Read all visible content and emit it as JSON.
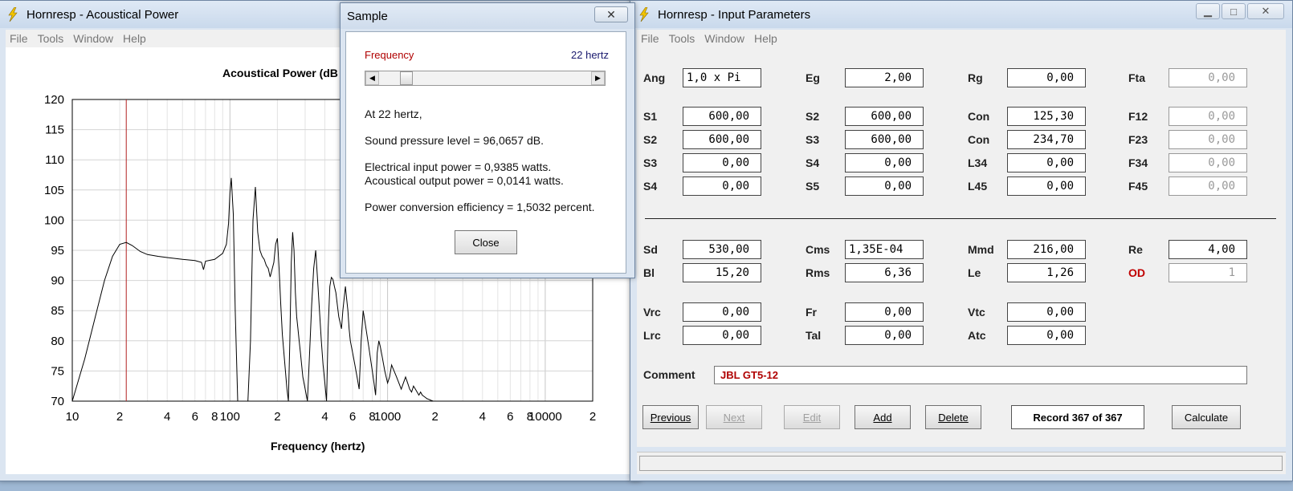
{
  "chart_window": {
    "title": "Hornresp - Acoustical Power",
    "menu": [
      "File",
      "Tools",
      "Window",
      "Help"
    ]
  },
  "chart_data": {
    "type": "line",
    "title": "Acoustical Power (dB",
    "xlabel": "Frequency (hertz)",
    "ylabel": "",
    "xscale": "log",
    "xlim": [
      10,
      20000
    ],
    "ylim": [
      70,
      120
    ],
    "y_ticks": [
      120,
      115,
      110,
      105,
      100,
      95,
      90,
      85,
      80,
      75,
      70
    ],
    "x_tick_labels": [
      {
        "x": 10,
        "label": "10"
      },
      {
        "x": 20,
        "label": "2"
      },
      {
        "x": 40,
        "label": "4"
      },
      {
        "x": 60,
        "label": "6"
      },
      {
        "x": 80,
        "label": "8"
      },
      {
        "x": 100,
        "label": "100"
      },
      {
        "x": 200,
        "label": "2"
      },
      {
        "x": 400,
        "label": "4"
      },
      {
        "x": 600,
        "label": "6"
      },
      {
        "x": 800,
        "label": "8"
      },
      {
        "x": 1000,
        "label": "1000"
      },
      {
        "x": 2000,
        "label": "2"
      },
      {
        "x": 4000,
        "label": "4"
      },
      {
        "x": 6000,
        "label": "6"
      },
      {
        "x": 8000,
        "label": "8"
      },
      {
        "x": 10000,
        "label": "10000"
      },
      {
        "x": 20000,
        "label": "2"
      }
    ],
    "marker_x": 22,
    "grid": true,
    "series": [
      {
        "x": [
          10,
          12,
          14,
          16,
          18,
          20,
          22,
          24,
          27,
          30,
          35,
          40,
          50,
          60,
          66,
          68,
          70,
          80,
          90,
          95,
          98,
          100,
          102,
          105,
          108,
          112,
          116,
          120,
          125,
          130,
          135,
          140,
          145,
          150,
          155,
          160,
          165,
          170,
          175,
          180,
          185,
          190,
          195,
          200,
          205,
          210,
          215,
          220,
          225,
          230,
          235,
          240,
          245,
          250,
          255,
          260,
          265,
          270,
          275,
          280,
          285,
          290,
          300,
          310,
          320,
          330,
          340,
          350,
          360,
          370,
          380,
          390,
          400,
          410,
          420,
          430,
          440,
          450,
          460,
          470,
          480,
          490,
          500,
          510,
          520,
          530,
          540,
          550,
          560,
          570,
          580,
          600,
          620,
          640,
          660,
          680,
          700,
          720,
          740,
          760,
          780,
          800,
          820,
          840,
          860,
          880,
          900,
          930,
          960,
          1000,
          1030,
          1060,
          1100,
          1140,
          1180,
          1220,
          1260,
          1300,
          1340,
          1380,
          1420,
          1460,
          1500,
          1540,
          1580,
          1620,
          1660,
          1700,
          1740,
          1780,
          1820,
          1860,
          1900,
          1950,
          2000
        ],
        "y": [
          70,
          77,
          84,
          90,
          94,
          96,
          96.3,
          95.8,
          94.8,
          94.3,
          94.0,
          93.8,
          93.5,
          93.3,
          93.0,
          91.8,
          93.2,
          93.5,
          94.5,
          96.0,
          99.5,
          104.5,
          107,
          101,
          85,
          70,
          70,
          70,
          70,
          70,
          80,
          100,
          105.5,
          98,
          95,
          94,
          93.5,
          92.5,
          92,
          90.6,
          91.8,
          93,
          96,
          97,
          92,
          86,
          81,
          78,
          75,
          72,
          70,
          80,
          93,
          98,
          95,
          88,
          84,
          82,
          80,
          78,
          76,
          74,
          72,
          70,
          78,
          86,
          92,
          95,
          90,
          85,
          80,
          76,
          73,
          70,
          82,
          89,
          90.5,
          90.2,
          89,
          88,
          86,
          84,
          83,
          82,
          85,
          87,
          89,
          87,
          85,
          82,
          80,
          78,
          76,
          74,
          72,
          80,
          85,
          83,
          81,
          79,
          77,
          75,
          73,
          71,
          78,
          80,
          79,
          77,
          75,
          73,
          74,
          76,
          75,
          74,
          73,
          72,
          73,
          74,
          73,
          72,
          71.5,
          72.5,
          72,
          71.5,
          71,
          71.5,
          71,
          70.8,
          70.6,
          70.4,
          70.3,
          70.2,
          70.1,
          70,
          70
        ]
      }
    ]
  },
  "sample_dialog": {
    "title": "Sample",
    "close_glyph": "✕",
    "frequency_label": "Frequency",
    "frequency_value": "22 hertz",
    "slider_value_hz": 22,
    "line_at": "At 22 hertz,",
    "line_spl": "Sound pressure level = 96,0657 dB.",
    "line_eip": "Electrical input power = 0,9385 watts.",
    "line_aop": "Acoustical output power = 0,0141 watts.",
    "line_pce": "Power conversion efficiency = 1,5032 percent.",
    "close_button": "Close"
  },
  "input_window": {
    "title": "Hornresp - Input Parameters",
    "menu": [
      "File",
      "Tools",
      "Window",
      "Help"
    ],
    "controls": {
      "minimize": "▁",
      "maximize": "□",
      "close": "✕"
    },
    "params": {
      "ang": {
        "label": "Ang",
        "value": "1,0 x Pi"
      },
      "eg": {
        "label": "Eg",
        "value": "2,00"
      },
      "rg": {
        "label": "Rg",
        "value": "0,00"
      },
      "fta": {
        "label": "Fta",
        "value": "0,00"
      },
      "s1": {
        "label": "S1",
        "value": "600,00"
      },
      "s2a": {
        "label": "S2",
        "value": "600,00"
      },
      "con1": {
        "label": "Con",
        "value": "125,30"
      },
      "f12": {
        "label": "F12",
        "value": "0,00"
      },
      "s2b": {
        "label": "S2",
        "value": "600,00"
      },
      "s3a": {
        "label": "S3",
        "value": "600,00"
      },
      "con2": {
        "label": "Con",
        "value": "234,70"
      },
      "f23": {
        "label": "F23",
        "value": "0,00"
      },
      "s3b": {
        "label": "S3",
        "value": "0,00"
      },
      "s4a": {
        "label": "S4",
        "value": "0,00"
      },
      "l34": {
        "label": "L34",
        "value": "0,00"
      },
      "f34": {
        "label": "F34",
        "value": "0,00"
      },
      "s4b": {
        "label": "S4",
        "value": "0,00"
      },
      "s5": {
        "label": "S5",
        "value": "0,00"
      },
      "l45": {
        "label": "L45",
        "value": "0,00"
      },
      "f45": {
        "label": "F45",
        "value": "0,00"
      },
      "sd": {
        "label": "Sd",
        "value": "530,00"
      },
      "cms": {
        "label": "Cms",
        "value": "1,35E-04"
      },
      "mmd": {
        "label": "Mmd",
        "value": "216,00"
      },
      "re": {
        "label": "Re",
        "value": "4,00"
      },
      "bl": {
        "label": "Bl",
        "value": "15,20"
      },
      "rms": {
        "label": "Rms",
        "value": "6,36"
      },
      "le": {
        "label": "Le",
        "value": "1,26"
      },
      "od": {
        "label": "OD",
        "value": "1"
      },
      "vrc": {
        "label": "Vrc",
        "value": "0,00"
      },
      "fr": {
        "label": "Fr",
        "value": "0,00"
      },
      "vtc": {
        "label": "Vtc",
        "value": "0,00"
      },
      "lrc": {
        "label": "Lrc",
        "value": "0,00"
      },
      "tal": {
        "label": "Tal",
        "value": "0,00"
      },
      "atc": {
        "label": "Atc",
        "value": "0,00"
      }
    },
    "comment_label": "Comment",
    "comment_value": "JBL GT5-12",
    "buttons": {
      "previous": "Previous",
      "next": "Next",
      "edit": "Edit",
      "add": "Add",
      "delete": "Delete",
      "calculate": "Calculate"
    },
    "record": "Record 367 of 367"
  }
}
